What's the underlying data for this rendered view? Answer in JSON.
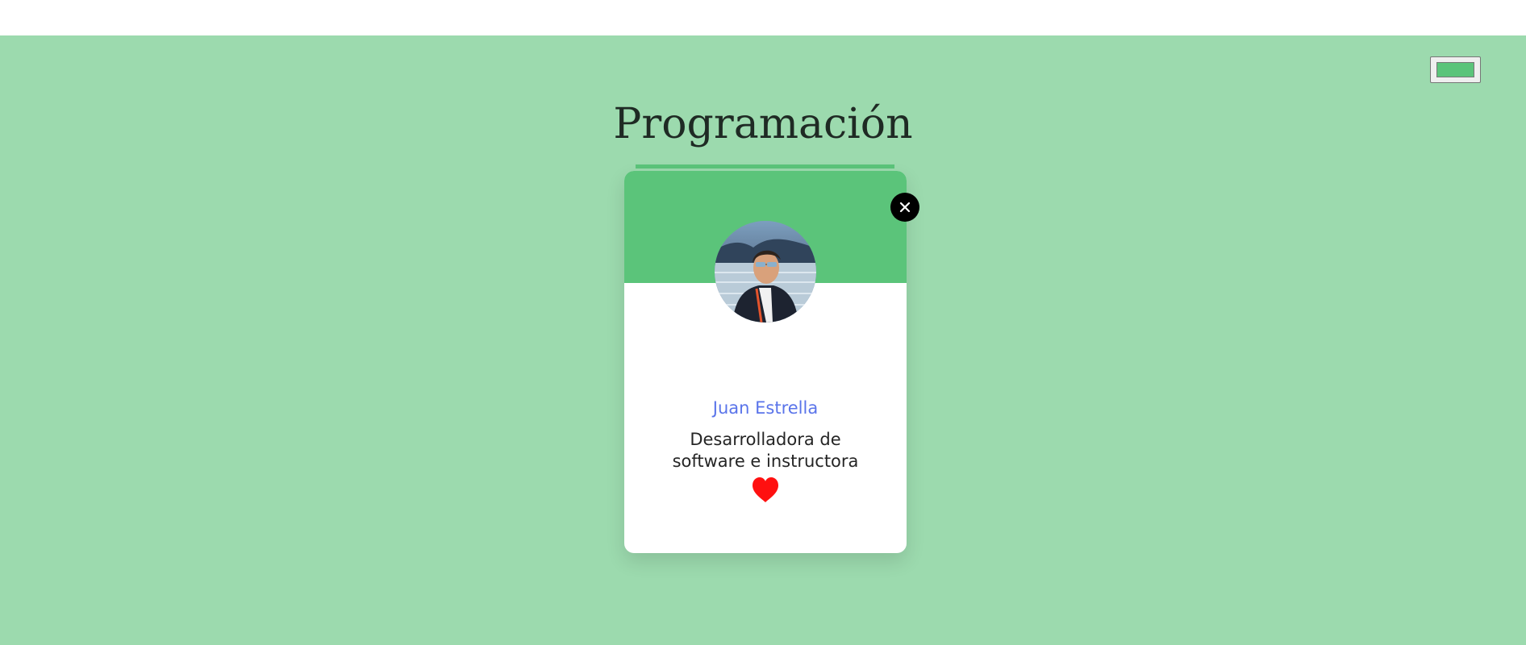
{
  "section": {
    "title": "Programación",
    "background_color": "#9cdaae",
    "accent_color": "#5bc47a"
  },
  "color_picker": {
    "value": "#5bc47a"
  },
  "card": {
    "name": "Juan Estrella",
    "role": "Desarrolladora de software e instructora",
    "avatar_icon": "profile-photo",
    "favorite_icon": "heart-icon",
    "close_icon": "close-icon"
  }
}
